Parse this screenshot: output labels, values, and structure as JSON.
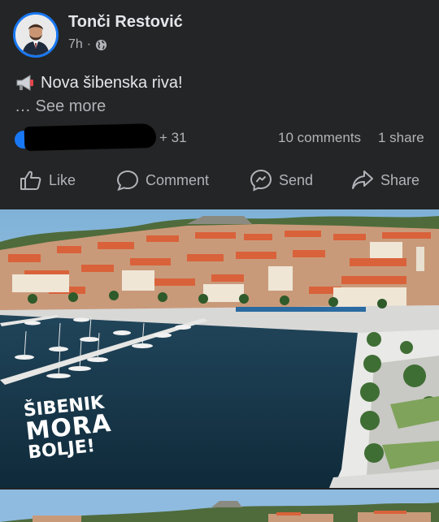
{
  "post": {
    "author": "Tonči Restović",
    "time": "7h",
    "separator": "·",
    "text": "Nova šibenska riva!",
    "see_more": "… See more",
    "privacy_icon": "globe-icon",
    "text_icon": "megaphone-icon"
  },
  "stats": {
    "reactions_extra": "+ 31",
    "comments": "10 comments",
    "shares": "1 share"
  },
  "actions": {
    "like": "Like",
    "comment": "Comment",
    "send": "Send",
    "share": "Share"
  },
  "photo": {
    "slogan_line1": "ŠIBENIK",
    "slogan_line2": "MORA",
    "slogan_line3": "BOLJE!"
  },
  "colors": {
    "background": "#242526",
    "accent": "#1877f2",
    "text": "#e4e6eb",
    "muted": "#b0b3b8"
  }
}
